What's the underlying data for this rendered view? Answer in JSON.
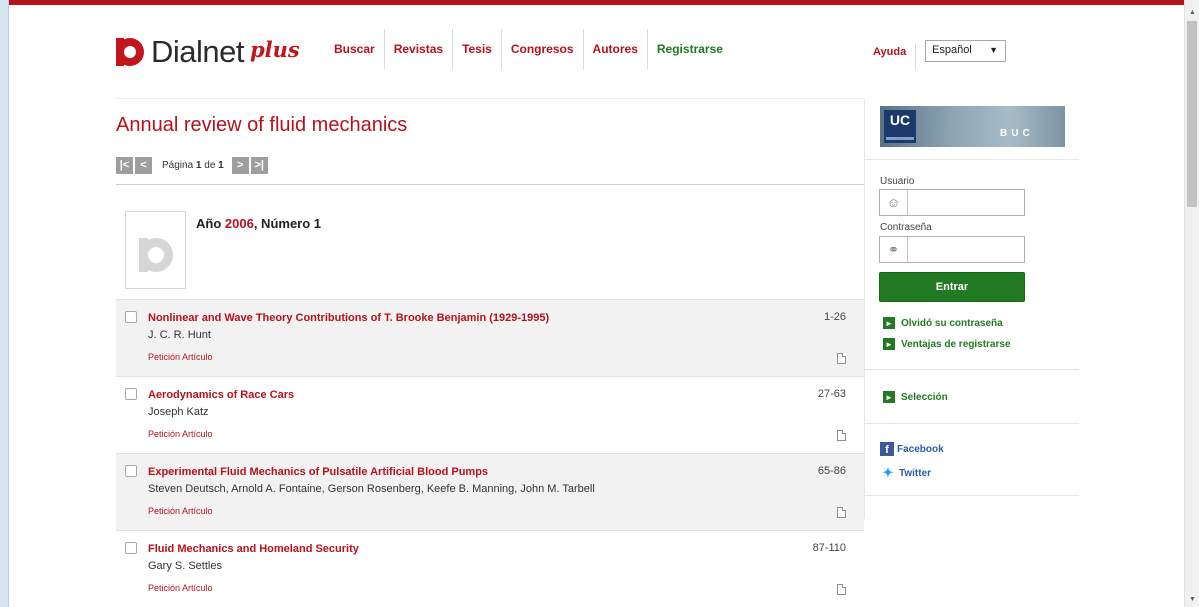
{
  "brand": {
    "name": "Dialnet",
    "plus": "plus"
  },
  "nav": {
    "items": [
      {
        "label": "Buscar"
      },
      {
        "label": "Revistas"
      },
      {
        "label": "Tesis"
      },
      {
        "label": "Congresos"
      },
      {
        "label": "Autores"
      },
      {
        "label": "Registrarse"
      }
    ],
    "help": "Ayuda",
    "language": "Español"
  },
  "journal": {
    "title": "Annual review of fluid mechanics",
    "pager": {
      "prefix": "Página",
      "current": "1",
      "sep": "de",
      "total": "1"
    },
    "issue": {
      "label_year": "Año",
      "year": "2006",
      "label_number": ", Número",
      "number": "1"
    }
  },
  "articles": [
    {
      "title": "Nonlinear and Wave Theory Contributions of T. Brooke Benjamin (1929-1995)",
      "authors": "J. C. R. Hunt",
      "request": "Petición Artículo",
      "pages": "1-26"
    },
    {
      "title": "Aerodynamics of Race Cars",
      "authors": "Joseph Katz",
      "request": "Petición Artículo",
      "pages": "27-63"
    },
    {
      "title": "Experimental Fluid Mechanics of Pulsatile Artificial Blood Pumps",
      "authors": "Steven Deutsch, Arnold A. Fontaine, Gerson Rosenberg, Keefe B. Manning, John M. Tarbell",
      "request": "Petición Artículo",
      "pages": "65-86"
    },
    {
      "title": "Fluid Mechanics and Homeland Security",
      "authors": "Gary S. Settles",
      "request": "Petición Artículo",
      "pages": "87-110"
    }
  ],
  "sidebar": {
    "banner": {
      "uc": "UC",
      "buc": "BUC"
    },
    "login": {
      "user_label": "Usuario",
      "password_label": "Contraseña",
      "submit": "Entrar",
      "forgot": "Olvidó su contraseña",
      "benefits": "Ventajas de registrarse"
    },
    "selection": "Selección",
    "social": {
      "facebook": "Facebook",
      "twitter": "Twitter"
    }
  },
  "colors": {
    "brand_red": "#b5121b",
    "brand_green": "#217a21",
    "facebook": "#3b5998",
    "twitter": "#1da1f2"
  }
}
